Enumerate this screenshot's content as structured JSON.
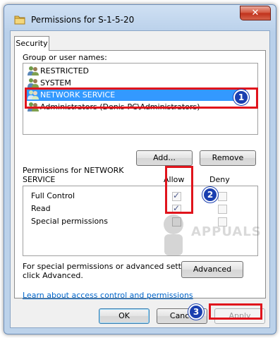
{
  "window": {
    "title": "Permissions for S-1-5-20",
    "close_label": "✕"
  },
  "tab": {
    "label": "Security"
  },
  "groups": {
    "label": "Group or user names:",
    "items": [
      {
        "label": "RESTRICTED"
      },
      {
        "label": "SYSTEM"
      },
      {
        "label": "NETWORK SERVICE",
        "selected": true
      },
      {
        "label": "Administrators (Denis-PC\\Administrators)"
      }
    ],
    "add_label": "Add...",
    "remove_label": "Remove"
  },
  "permissions": {
    "label_line1": "Permissions for NETWORK",
    "label_line2": "SERVICE",
    "allow_header": "Allow",
    "deny_header": "Deny",
    "rows": [
      {
        "label": "Full Control",
        "allow": true,
        "deny": false
      },
      {
        "label": "Read",
        "allow": true,
        "deny": false
      },
      {
        "label": "Special permissions",
        "allow": false,
        "deny": false
      }
    ]
  },
  "advanced": {
    "text_line1": "For special permissions or advanced settings,",
    "text_line2": "click Advanced.",
    "button_label": "Advanced"
  },
  "link": {
    "label": "Learn about access control and permissions"
  },
  "footer": {
    "ok_label": "OK",
    "cancel_label": "Cance",
    "apply_label": "Apply"
  },
  "annotations": {
    "badges": [
      "1",
      "2",
      "3"
    ],
    "highlight_color": "#e0141c",
    "badge_color": "#1a3fb0"
  },
  "watermark": {
    "text": "APPUALS"
  }
}
